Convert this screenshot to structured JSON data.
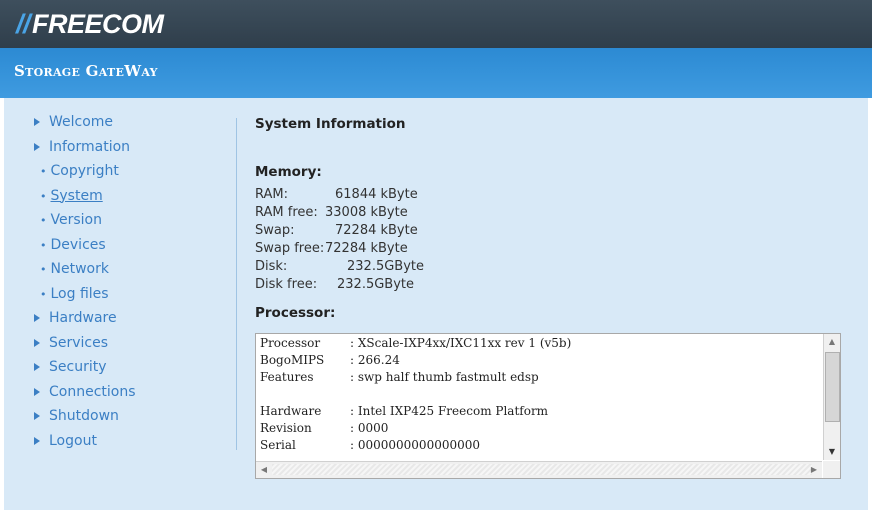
{
  "header": {
    "brand_slashes": "//",
    "brand_name": "FREECOM",
    "product": "Storage GateWay"
  },
  "nav": {
    "welcome": "Welcome",
    "information": "Information",
    "copyright": "Copyright",
    "system": "System",
    "version": "Version",
    "devices": "Devices",
    "network": "Network",
    "logfiles": "Log files",
    "hardware": "Hardware",
    "services": "Services",
    "security": "Security",
    "connections": "Connections",
    "shutdown": "Shutdown",
    "logout": "Logout",
    "bullet": "•"
  },
  "main": {
    "title": "System Information",
    "memory_title": "Memory:",
    "memory": [
      {
        "label": "RAM:",
        "value": "61844 kByte"
      },
      {
        "label": "RAM free:",
        "value": "33008 kByte"
      },
      {
        "label": "Swap:",
        "value": "72284 kByte"
      },
      {
        "label": "Swap free:",
        "value": "72284 kByte"
      },
      {
        "label": "Disk:",
        "value": "232.5GByte"
      },
      {
        "label": "Disk free:",
        "value": "232.5GByte"
      }
    ],
    "processor_title": "Processor:",
    "processor": [
      {
        "key": "Processor",
        "value": ": XScale-IXP4xx/IXC11xx rev 1 (v5b)"
      },
      {
        "key": "BogoMIPS",
        "value": ": 266.24"
      },
      {
        "key": "Features",
        "value": ": swp half thumb fastmult edsp"
      },
      {
        "key": "",
        "value": ""
      },
      {
        "key": "Hardware",
        "value": ": Intel IXP425 Freecom Platform"
      },
      {
        "key": "Revision",
        "value": ": 0000"
      },
      {
        "key": "Serial",
        "value": ": 0000000000000000"
      }
    ]
  },
  "colors": {
    "topbar": "#34434f",
    "subbar": "#3592da",
    "content_bg": "#d8e9f7",
    "link": "#3b7fc4"
  }
}
